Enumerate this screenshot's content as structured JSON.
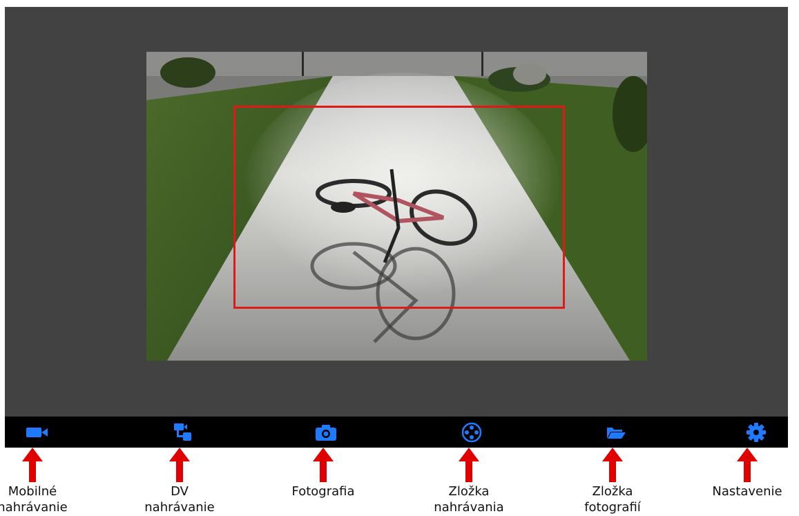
{
  "colors": {
    "accent": "#1e7bff",
    "toolbar_bg": "#000000",
    "screen_bg": "#424242",
    "focus_box": "#e01818",
    "callout_arrow": "#e00000"
  },
  "preview": {
    "focus_box_visible": true
  },
  "toolbar": {
    "items": [
      {
        "icon": "video-camera-icon",
        "label": "Mobilné\nnahrávanie"
      },
      {
        "icon": "dv-recorder-icon",
        "label": "DV\nnahrávanie"
      },
      {
        "icon": "camera-icon",
        "label": "Fotografia"
      },
      {
        "icon": "film-reel-icon",
        "label": "Zložka\nnahrávania"
      },
      {
        "icon": "folder-open-icon",
        "label": "Zložka\nfotografií"
      },
      {
        "icon": "gear-icon",
        "label": "Nastavenie"
      }
    ]
  }
}
